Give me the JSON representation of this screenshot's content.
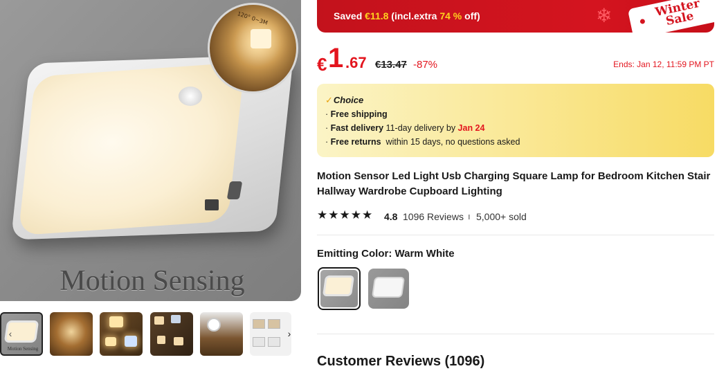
{
  "gallery": {
    "caption": "Motion Sensing",
    "inset_label": "120° 0~3M",
    "thumb_caption": "Motion Sensing",
    "prev_icon": "chevron-left-icon",
    "next_icon": "chevron-right-icon"
  },
  "sale": {
    "prefix": "Saved ",
    "amount": "€11.8",
    "middle": " (incl.extra ",
    "percent": "74 %",
    "suffix": " off)",
    "tag_line1": "Winter",
    "tag_line2": "Sale"
  },
  "price": {
    "symbol": "€",
    "integer": "1",
    "decimal": ".67",
    "original": "€13.47",
    "discount": "-87%",
    "ends": "Ends: Jan 12, 11:59 PM PT"
  },
  "choice": {
    "title": "Choice",
    "line1_label": "Free shipping",
    "line2_label": "Fast delivery",
    "line2_text": " 11-day delivery by ",
    "line2_date": "Jan 24",
    "line3_label": "Free returns",
    "line3_text": "  within 15 days, no questions asked"
  },
  "product": {
    "title": "Motion Sensor Led Light Usb Charging Square Lamp for Bedroom Kitchen Stair Hallway Wardrobe Cupboard Lighting"
  },
  "rating": {
    "stars": "★★★★★",
    "value": "4.8",
    "reviews": "1096 Reviews",
    "separator": "ı",
    "sold": "5,000+ sold"
  },
  "variant": {
    "label": "Emitting Color: ",
    "selected": "Warm White"
  },
  "reviews_section": {
    "title": "Customer Reviews (1096)"
  },
  "colors": {
    "accent_red": "#e3151e",
    "banner_red": "#d4141f",
    "highlight_yellow": "#ffd21f"
  }
}
